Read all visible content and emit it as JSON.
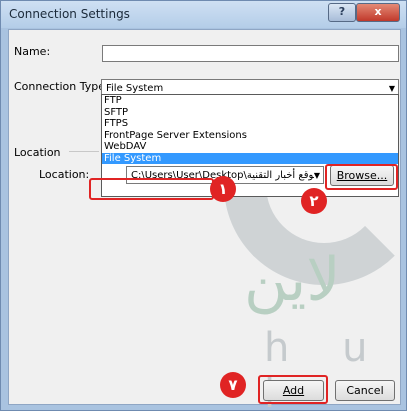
{
  "window": {
    "title": "Connection Settings",
    "help_glyph": "?",
    "close_glyph": "x"
  },
  "form": {
    "name_label": "Name:",
    "name_value": "",
    "connection_type_label": "Connection Type:",
    "connection_type_value": "File System",
    "connection_type_options": [
      "FTP",
      "SFTP",
      "FTPS",
      "FrontPage Server Extensions",
      "WebDAV",
      "File System"
    ],
    "location_group_label": "Location",
    "location_label": "Location:",
    "location_value": "C:\\Users\\User\\Desktop\\موقع أخبار التقنية",
    "browse_label": "Browse...",
    "add_label": "Add",
    "cancel_label": "Cancel"
  },
  "annotations": {
    "marker1": "١",
    "marker2": "٢",
    "marker7": "٧",
    "color": "#e02424"
  },
  "watermark": {
    "arabic": "لاين",
    "latin": "h u l"
  }
}
